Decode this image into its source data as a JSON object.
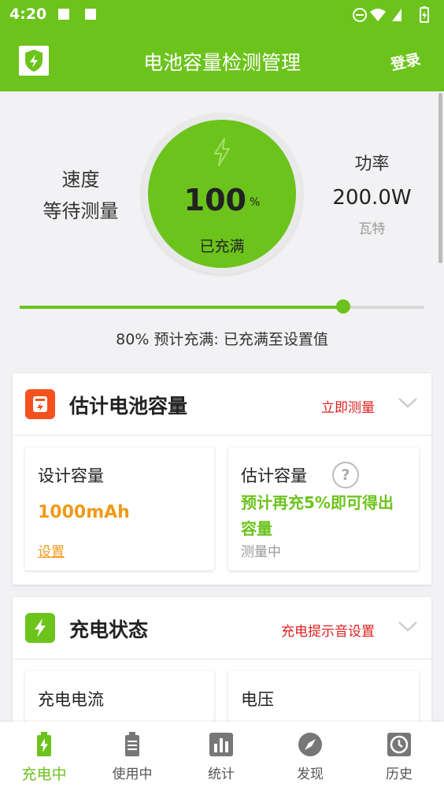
{
  "status_bar": {
    "time": "4:20"
  },
  "app_bar": {
    "title": "电池容量检测管理",
    "login": "登录"
  },
  "gauge": {
    "left_line1": "速度",
    "left_line2": "等待测量",
    "value": "100",
    "unit": "%",
    "status": "已充满",
    "right_label": "功率",
    "right_value": "200.0W",
    "right_unit": "瓦特"
  },
  "charge_limit": {
    "percent": 0.8,
    "text": "80%  预计充满: 已充满至设置值"
  },
  "capacity_card": {
    "title": "估计电池容量",
    "action": "立即测量",
    "design": {
      "label": "设计容量",
      "value": "1000mAh",
      "link": "设置"
    },
    "estimate": {
      "label": "估计容量",
      "help_icon": "?",
      "value": "预计再充5%即可得出容量",
      "status": "测量中"
    }
  },
  "charging_card": {
    "title": "充电状态",
    "action": "充电提示音设置",
    "current_label": "充电电流",
    "voltage_label": "电压"
  },
  "bottom_nav": [
    {
      "label": "充电中",
      "icon": "battery-charging-icon"
    },
    {
      "label": "使用中",
      "icon": "battery-icon"
    },
    {
      "label": "统计",
      "icon": "bar-chart-icon"
    },
    {
      "label": "发现",
      "icon": "compass-icon"
    },
    {
      "label": "历史",
      "icon": "clock-icon"
    }
  ],
  "colors": {
    "accent": "#6cc31c",
    "warning": "#ef9a1a",
    "alert": "#e02020",
    "capacity_icon": "#f4511e"
  }
}
